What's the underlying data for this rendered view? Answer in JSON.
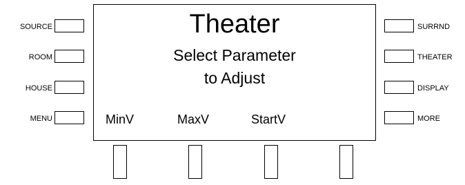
{
  "left_buttons": [
    {
      "label": "SOURCE"
    },
    {
      "label": "ROOM"
    },
    {
      "label": "HOUSE"
    },
    {
      "label": "MENU"
    }
  ],
  "right_buttons": [
    {
      "label": "SURRND"
    },
    {
      "label": "THEATER"
    },
    {
      "label": "DISPLAY"
    },
    {
      "label": "MORE"
    }
  ],
  "screen": {
    "title": "Theater",
    "line1": "Select Parameter",
    "line2": "to Adjust",
    "softkeys": [
      "MinV",
      "MaxV",
      "StartV",
      ""
    ]
  }
}
